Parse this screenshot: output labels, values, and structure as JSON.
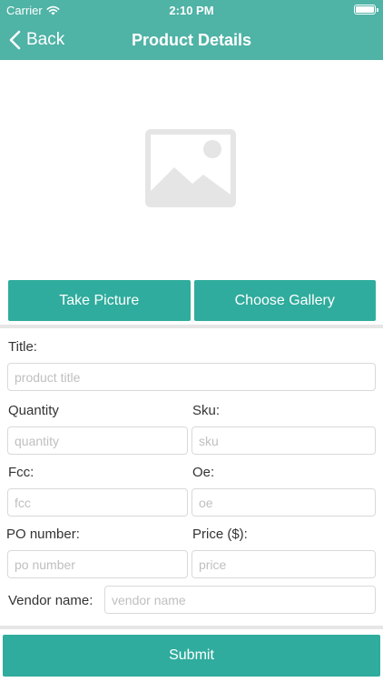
{
  "status_bar": {
    "carrier": "Carrier",
    "time": "2:10 PM"
  },
  "nav": {
    "back_label": "Back",
    "title": "Product Details"
  },
  "image_placeholder_icon": "image-placeholder-icon",
  "photo_actions": {
    "take_picture": "Take Picture",
    "choose_gallery": "Choose Gallery"
  },
  "form": {
    "title": {
      "label": "Title:",
      "placeholder": "product title"
    },
    "quantity": {
      "label": "Quantity",
      "placeholder": "quantity"
    },
    "sku": {
      "label": "Sku:",
      "placeholder": "sku"
    },
    "fcc": {
      "label": "Fcc:",
      "placeholder": "fcc"
    },
    "oe": {
      "label": "Oe:",
      "placeholder": "oe"
    },
    "po_number": {
      "label": "PO number:",
      "placeholder": "po number"
    },
    "price": {
      "label": "Price ($):",
      "placeholder": "price"
    },
    "vendor_name": {
      "label": "Vendor name:",
      "placeholder": "vendor name"
    }
  },
  "submit_label": "Submit",
  "colors": {
    "header": "#4fb3a6",
    "button": "#2fac9d",
    "separator": "#e6e6e6",
    "placeholder_icon": "#e5e5e5"
  }
}
